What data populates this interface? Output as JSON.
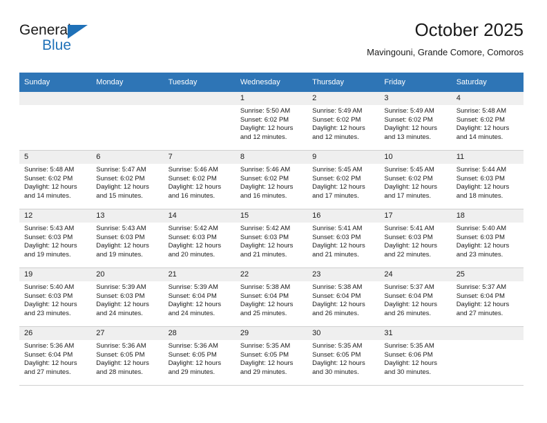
{
  "brand": {
    "name_top": "General",
    "name_bottom": "Blue",
    "accent_color": "#1f71b8"
  },
  "header": {
    "title": "October 2025",
    "subtitle": "Mavingouni, Grande Comore, Comoros"
  },
  "calendar": {
    "header_bg": "#2e75b6",
    "daynum_bg": "#efefef",
    "weekday_headers": [
      "Sunday",
      "Monday",
      "Tuesday",
      "Wednesday",
      "Thursday",
      "Friday",
      "Saturday"
    ],
    "weeks": [
      [
        {
          "day": "",
          "lines": []
        },
        {
          "day": "",
          "lines": []
        },
        {
          "day": "",
          "lines": []
        },
        {
          "day": "1",
          "lines": [
            "Sunrise: 5:50 AM",
            "Sunset: 6:02 PM",
            "Daylight: 12 hours",
            "and 12 minutes."
          ]
        },
        {
          "day": "2",
          "lines": [
            "Sunrise: 5:49 AM",
            "Sunset: 6:02 PM",
            "Daylight: 12 hours",
            "and 12 minutes."
          ]
        },
        {
          "day": "3",
          "lines": [
            "Sunrise: 5:49 AM",
            "Sunset: 6:02 PM",
            "Daylight: 12 hours",
            "and 13 minutes."
          ]
        },
        {
          "day": "4",
          "lines": [
            "Sunrise: 5:48 AM",
            "Sunset: 6:02 PM",
            "Daylight: 12 hours",
            "and 14 minutes."
          ]
        }
      ],
      [
        {
          "day": "5",
          "lines": [
            "Sunrise: 5:48 AM",
            "Sunset: 6:02 PM",
            "Daylight: 12 hours",
            "and 14 minutes."
          ]
        },
        {
          "day": "6",
          "lines": [
            "Sunrise: 5:47 AM",
            "Sunset: 6:02 PM",
            "Daylight: 12 hours",
            "and 15 minutes."
          ]
        },
        {
          "day": "7",
          "lines": [
            "Sunrise: 5:46 AM",
            "Sunset: 6:02 PM",
            "Daylight: 12 hours",
            "and 16 minutes."
          ]
        },
        {
          "day": "8",
          "lines": [
            "Sunrise: 5:46 AM",
            "Sunset: 6:02 PM",
            "Daylight: 12 hours",
            "and 16 minutes."
          ]
        },
        {
          "day": "9",
          "lines": [
            "Sunrise: 5:45 AM",
            "Sunset: 6:02 PM",
            "Daylight: 12 hours",
            "and 17 minutes."
          ]
        },
        {
          "day": "10",
          "lines": [
            "Sunrise: 5:45 AM",
            "Sunset: 6:02 PM",
            "Daylight: 12 hours",
            "and 17 minutes."
          ]
        },
        {
          "day": "11",
          "lines": [
            "Sunrise: 5:44 AM",
            "Sunset: 6:03 PM",
            "Daylight: 12 hours",
            "and 18 minutes."
          ]
        }
      ],
      [
        {
          "day": "12",
          "lines": [
            "Sunrise: 5:43 AM",
            "Sunset: 6:03 PM",
            "Daylight: 12 hours",
            "and 19 minutes."
          ]
        },
        {
          "day": "13",
          "lines": [
            "Sunrise: 5:43 AM",
            "Sunset: 6:03 PM",
            "Daylight: 12 hours",
            "and 19 minutes."
          ]
        },
        {
          "day": "14",
          "lines": [
            "Sunrise: 5:42 AM",
            "Sunset: 6:03 PM",
            "Daylight: 12 hours",
            "and 20 minutes."
          ]
        },
        {
          "day": "15",
          "lines": [
            "Sunrise: 5:42 AM",
            "Sunset: 6:03 PM",
            "Daylight: 12 hours",
            "and 21 minutes."
          ]
        },
        {
          "day": "16",
          "lines": [
            "Sunrise: 5:41 AM",
            "Sunset: 6:03 PM",
            "Daylight: 12 hours",
            "and 21 minutes."
          ]
        },
        {
          "day": "17",
          "lines": [
            "Sunrise: 5:41 AM",
            "Sunset: 6:03 PM",
            "Daylight: 12 hours",
            "and 22 minutes."
          ]
        },
        {
          "day": "18",
          "lines": [
            "Sunrise: 5:40 AM",
            "Sunset: 6:03 PM",
            "Daylight: 12 hours",
            "and 23 minutes."
          ]
        }
      ],
      [
        {
          "day": "19",
          "lines": [
            "Sunrise: 5:40 AM",
            "Sunset: 6:03 PM",
            "Daylight: 12 hours",
            "and 23 minutes."
          ]
        },
        {
          "day": "20",
          "lines": [
            "Sunrise: 5:39 AM",
            "Sunset: 6:03 PM",
            "Daylight: 12 hours",
            "and 24 minutes."
          ]
        },
        {
          "day": "21",
          "lines": [
            "Sunrise: 5:39 AM",
            "Sunset: 6:04 PM",
            "Daylight: 12 hours",
            "and 24 minutes."
          ]
        },
        {
          "day": "22",
          "lines": [
            "Sunrise: 5:38 AM",
            "Sunset: 6:04 PM",
            "Daylight: 12 hours",
            "and 25 minutes."
          ]
        },
        {
          "day": "23",
          "lines": [
            "Sunrise: 5:38 AM",
            "Sunset: 6:04 PM",
            "Daylight: 12 hours",
            "and 26 minutes."
          ]
        },
        {
          "day": "24",
          "lines": [
            "Sunrise: 5:37 AM",
            "Sunset: 6:04 PM",
            "Daylight: 12 hours",
            "and 26 minutes."
          ]
        },
        {
          "day": "25",
          "lines": [
            "Sunrise: 5:37 AM",
            "Sunset: 6:04 PM",
            "Daylight: 12 hours",
            "and 27 minutes."
          ]
        }
      ],
      [
        {
          "day": "26",
          "lines": [
            "Sunrise: 5:36 AM",
            "Sunset: 6:04 PM",
            "Daylight: 12 hours",
            "and 27 minutes."
          ]
        },
        {
          "day": "27",
          "lines": [
            "Sunrise: 5:36 AM",
            "Sunset: 6:05 PM",
            "Daylight: 12 hours",
            "and 28 minutes."
          ]
        },
        {
          "day": "28",
          "lines": [
            "Sunrise: 5:36 AM",
            "Sunset: 6:05 PM",
            "Daylight: 12 hours",
            "and 29 minutes."
          ]
        },
        {
          "day": "29",
          "lines": [
            "Sunrise: 5:35 AM",
            "Sunset: 6:05 PM",
            "Daylight: 12 hours",
            "and 29 minutes."
          ]
        },
        {
          "day": "30",
          "lines": [
            "Sunrise: 5:35 AM",
            "Sunset: 6:05 PM",
            "Daylight: 12 hours",
            "and 30 minutes."
          ]
        },
        {
          "day": "31",
          "lines": [
            "Sunrise: 5:35 AM",
            "Sunset: 6:06 PM",
            "Daylight: 12 hours",
            "and 30 minutes."
          ]
        },
        {
          "day": "",
          "lines": []
        }
      ]
    ]
  }
}
